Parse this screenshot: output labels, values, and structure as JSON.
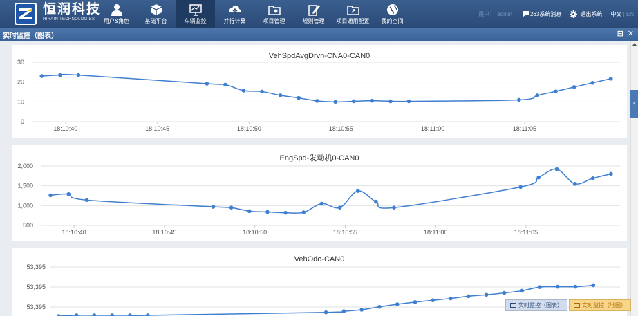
{
  "brand": {
    "name_cn": "恒润科技",
    "name_en": "HIRAIN TECHNOLOGIES"
  },
  "nav": [
    {
      "label": "用户&角色",
      "icon": "user-icon"
    },
    {
      "label": "基础平台",
      "icon": "cube-icon"
    },
    {
      "label": "车辆监控",
      "icon": "monitor-chart-icon",
      "active": true
    },
    {
      "label": "并行计算",
      "icon": "cloud-upload-icon"
    },
    {
      "label": "项目管理",
      "icon": "folder-gear-icon"
    },
    {
      "label": "规则管理",
      "icon": "edit-doc-icon"
    },
    {
      "label": "项目通用配置",
      "icon": "folder-settings-icon"
    },
    {
      "label": "我的空间",
      "icon": "globe-icon"
    }
  ],
  "user": {
    "prefix": "用户：",
    "name": "admin",
    "messages_count": "263",
    "messages_label": "系统消息",
    "logout_label": "退出系统",
    "lang_cn": "中文",
    "lang_sep": "|",
    "lang_en": "EN"
  },
  "panel": {
    "title": "实时监控（图表）",
    "minimize": "_",
    "restore": "⊟",
    "close": "✕"
  },
  "side_tab": {
    "label": "‹"
  },
  "bottom_tabs": {
    "tab1": "实时监控（图表）",
    "tab2": "实时监控（地图）"
  },
  "colors": {
    "line": "#3f7fd0",
    "grid": "#e2e2e2",
    "nav_active": "#1f3b62"
  },
  "chart_data": [
    {
      "type": "line",
      "title": "VehSpdAvgDrvn-CNA0-CAN0",
      "yticks": [
        "0",
        "10",
        "20",
        "30"
      ],
      "ylim": [
        0,
        30
      ],
      "xticks": [
        "18:10:40",
        "18:10:45",
        "18:10:50",
        "18:10:55",
        "18:11:00",
        "18:11:05"
      ],
      "x": [
        0,
        1,
        2,
        9,
        10,
        11,
        12,
        13,
        14,
        15,
        16,
        17,
        18,
        19,
        20,
        26,
        27,
        28,
        29,
        30,
        31
      ],
      "values": [
        23,
        23.5,
        23.5,
        19.2,
        18.7,
        15.7,
        15.2,
        13.3,
        12,
        10.5,
        10,
        10.3,
        10.6,
        10.3,
        10.3,
        11,
        13.3,
        15.3,
        17.5,
        19.6,
        21.7
      ],
      "xlim": [
        -0.5,
        31.5
      ],
      "tick_x": [
        1.3,
        6.3,
        11.3,
        16.3,
        21.3,
        26.3
      ]
    },
    {
      "type": "line",
      "title": "EngSpd-发动机0-CAN0",
      "yticks": [
        "500",
        "1,000",
        "1,500",
        "2,000"
      ],
      "ylim": [
        500,
        2000
      ],
      "xticks": [
        "18:10:40",
        "18:10:45",
        "18:10:50",
        "18:10:55",
        "18:11:00",
        "18:11:05"
      ],
      "x": [
        0,
        1,
        2,
        9,
        10,
        11,
        12,
        13,
        14,
        15,
        16,
        17,
        18,
        19,
        26,
        27,
        28,
        29,
        30,
        31
      ],
      "values": [
        1260,
        1290,
        1140,
        970,
        950,
        860,
        840,
        820,
        830,
        1050,
        950,
        1370,
        1100,
        950,
        1470,
        1710,
        1920,
        1550,
        1690,
        1800
      ],
      "xlim": [
        -0.5,
        31.5
      ],
      "tick_x": [
        1.3,
        6.3,
        11.3,
        16.3,
        21.3,
        26.3
      ]
    },
    {
      "type": "line",
      "title": "VehOdo-CAN0",
      "yticks": [
        "53,395",
        "53,395",
        "53,395"
      ],
      "x": [
        0,
        1,
        2,
        3,
        4,
        5,
        15,
        16,
        17,
        18,
        19,
        20,
        21,
        22,
        23,
        24,
        25,
        26,
        27,
        28,
        29,
        30
      ],
      "values": [
        0.0,
        0.02,
        0.02,
        0.02,
        0.02,
        0.02,
        0.1,
        0.13,
        0.17,
        0.25,
        0.32,
        0.38,
        0.43,
        0.48,
        0.54,
        0.58,
        0.63,
        0.69,
        0.79,
        0.8,
        0.8,
        0.84
      ],
      "ylim": [
        -0.1,
        1.4
      ],
      "xlim": [
        -0.5,
        31.5
      ]
    }
  ]
}
